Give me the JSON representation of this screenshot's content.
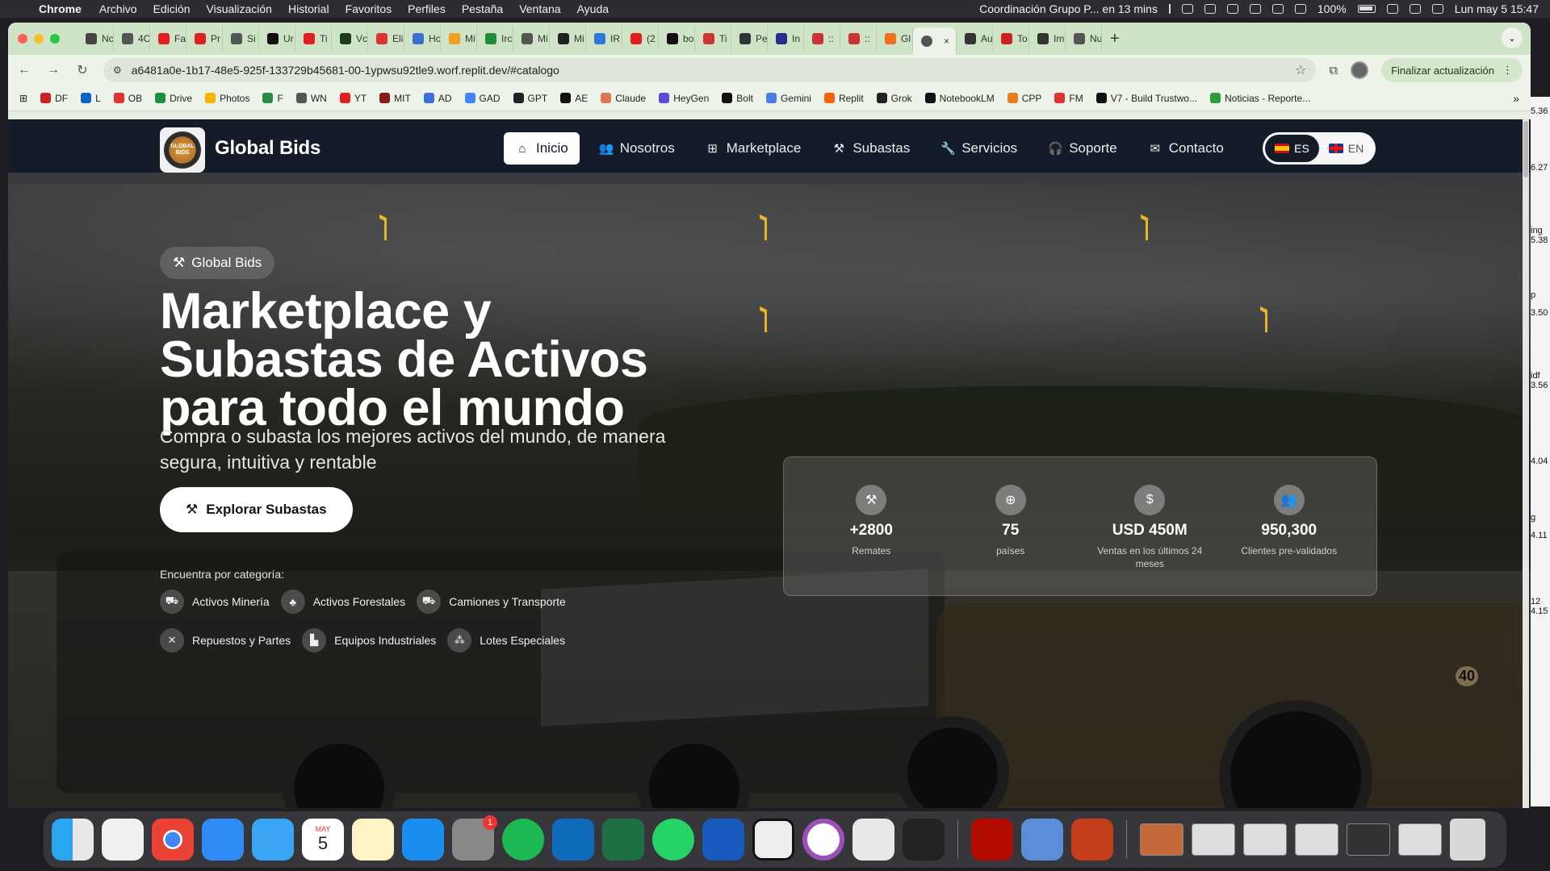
{
  "menubar": {
    "app": "Chrome",
    "items": [
      "Archivo",
      "Edición",
      "Visualización",
      "Historial",
      "Favoritos",
      "Perfiles",
      "Pestaña",
      "Ventana",
      "Ayuda"
    ],
    "meeting": "Coordinación Grupo P... en 13 mins",
    "battery": "100%",
    "datetime": "Lun may 5  15:47"
  },
  "tabs": [
    {
      "label": "Nc",
      "color": "#444"
    },
    {
      "label": "4C",
      "color": "#555"
    },
    {
      "label": "Fa",
      "color": "#e02020"
    },
    {
      "label": "Pr",
      "color": "#e02020"
    },
    {
      "label": "Si",
      "color": "#555"
    },
    {
      "label": "Ur",
      "color": "#111"
    },
    {
      "label": "Ti",
      "color": "#e02020"
    },
    {
      "label": "Vc",
      "color": "#1a3d1a"
    },
    {
      "label": "Eli",
      "color": "#d33"
    },
    {
      "label": "Hc",
      "color": "#3a6fd8"
    },
    {
      "label": "Mi",
      "color": "#f0a020"
    },
    {
      "label": "Irc",
      "color": "#1e8e3e"
    },
    {
      "label": "Mi",
      "color": "#555"
    },
    {
      "label": "Mi",
      "color": "#222"
    },
    {
      "label": "IR",
      "color": "#2a78d8"
    },
    {
      "label": "(2",
      "color": "#e02020"
    },
    {
      "label": "bo",
      "color": "#111"
    },
    {
      "label": "Ti",
      "color": "#c33"
    },
    {
      "label": "Pe",
      "color": "#333"
    },
    {
      "label": "In",
      "color": "#2b2b8a"
    },
    {
      "label": "::",
      "color": "#c33"
    },
    {
      "label": "::",
      "color": "#c33"
    },
    {
      "label": "Gl",
      "color": "#f07020"
    }
  ],
  "active_tab": {
    "label": "Gl",
    "close": "×"
  },
  "tabs_after": [
    {
      "label": "Au",
      "color": "#333"
    },
    {
      "label": "To",
      "color": "#c22"
    },
    {
      "label": "Im",
      "color": "#333"
    },
    {
      "label": "Nu",
      "color": "#555"
    }
  ],
  "toolbar": {
    "url": "a6481a0e-1b17-48e5-925f-133729b45681-00-1ypwsu92tle9.worf.replit.dev/#catalogo",
    "update_label": "Finalizar actualización"
  },
  "bookmarks": [
    {
      "label": "DF",
      "color": "#c22"
    },
    {
      "label": "L",
      "color": "#0a66c2"
    },
    {
      "label": "OB",
      "color": "#d33"
    },
    {
      "label": "Drive",
      "color": "#1e8e3e"
    },
    {
      "label": "Photos",
      "color": "#f4b400"
    },
    {
      "label": "F",
      "color": "#2a8a4a"
    },
    {
      "label": "WN",
      "color": "#555"
    },
    {
      "label": "YT",
      "color": "#e02020"
    },
    {
      "label": "MIT",
      "color": "#8a1a1a"
    },
    {
      "label": "AD",
      "color": "#3a6fd8"
    },
    {
      "label": "GAD",
      "color": "#4285f4"
    },
    {
      "label": "GPT",
      "color": "#222"
    },
    {
      "label": "AE",
      "color": "#111"
    },
    {
      "label": "Claude",
      "color": "#d97757"
    },
    {
      "label": "HeyGen",
      "color": "#5b4bdb"
    },
    {
      "label": "Bolt",
      "color": "#111"
    },
    {
      "label": "Gemini",
      "color": "#4a7de8"
    },
    {
      "label": "Replit",
      "color": "#f26207"
    },
    {
      "label": "Grok",
      "color": "#222"
    },
    {
      "label": "NotebookLM",
      "color": "#111"
    },
    {
      "label": "CPP",
      "color": "#e67e22"
    },
    {
      "label": "FM",
      "color": "#d33"
    },
    {
      "label": "V7 - Build Trustwo...",
      "color": "#111"
    },
    {
      "label": "Noticias - Reporte...",
      "color": "#2e9a3a"
    }
  ],
  "site": {
    "brand": "Global Bids",
    "logo_text": "GLOBAL BIDS",
    "nav": [
      {
        "label": "Inicio",
        "icon": "home-icon",
        "glyph": "⌂",
        "active": true
      },
      {
        "label": "Nosotros",
        "icon": "users-icon",
        "glyph": "👥",
        "active": false
      },
      {
        "label": "Marketplace",
        "icon": "store-icon",
        "glyph": "⊞",
        "active": false
      },
      {
        "label": "Subastas",
        "icon": "gavel-icon",
        "glyph": "⚒",
        "active": false
      },
      {
        "label": "Servicios",
        "icon": "wrench-icon",
        "glyph": "🔧",
        "active": false
      },
      {
        "label": "Soporte",
        "icon": "headset-icon",
        "glyph": "🎧",
        "active": false
      },
      {
        "label": "Contacto",
        "icon": "envelope-icon",
        "glyph": "✉",
        "active": false
      }
    ],
    "lang": {
      "es": "ES",
      "en": "EN",
      "selected": "ES"
    },
    "hero": {
      "badge": "Global Bids",
      "title": "Marketplace y Subastas de Activos para todo el mundo",
      "subtitle": "Compra o subasta los mejores activos del mundo, de manera segura, intuitiva y rentable",
      "cta": "Explorar Subastas",
      "category_label": "Encuentra por categoría:",
      "categories": [
        {
          "label": "Activos Minería",
          "icon": "mining-icon",
          "glyph": "⛟"
        },
        {
          "label": "Activos Forestales",
          "icon": "tree-icon",
          "glyph": "♣"
        },
        {
          "label": "Camiones y Transporte",
          "icon": "truck-icon",
          "glyph": "⛟"
        },
        {
          "label": "Repuestos y Partes",
          "icon": "tools-icon",
          "glyph": "✕"
        },
        {
          "label": "Equipos Industriales",
          "icon": "factory-icon",
          "glyph": "▙"
        },
        {
          "label": "Lotes Especiales",
          "icon": "boxes-icon",
          "glyph": "⁂"
        }
      ]
    },
    "stats": [
      {
        "value": "+2800",
        "label": "Remates",
        "icon": "gavel-icon",
        "glyph": "⚒"
      },
      {
        "value": "75",
        "label": "países",
        "icon": "globe-icon",
        "glyph": "⊕"
      },
      {
        "value": "USD 450M",
        "label": "Ventas en los últimos 24 meses",
        "icon": "dollar-icon",
        "glyph": "$"
      },
      {
        "value": "950,300",
        "label": "Clientes pre-validados",
        "icon": "users-icon",
        "glyph": "👥"
      }
    ],
    "watermark_number": "40"
  },
  "side_window_text": [
    "5.36",
    "6.27",
    "ing",
    "5.38",
    "p",
    "3.50",
    "idf",
    "3.56",
    "4.04",
    "g",
    "4.11",
    "12",
    "4.15"
  ],
  "dock": {
    "calendar_month": "MAY",
    "calendar_day": "5",
    "settings_badge": "1"
  }
}
